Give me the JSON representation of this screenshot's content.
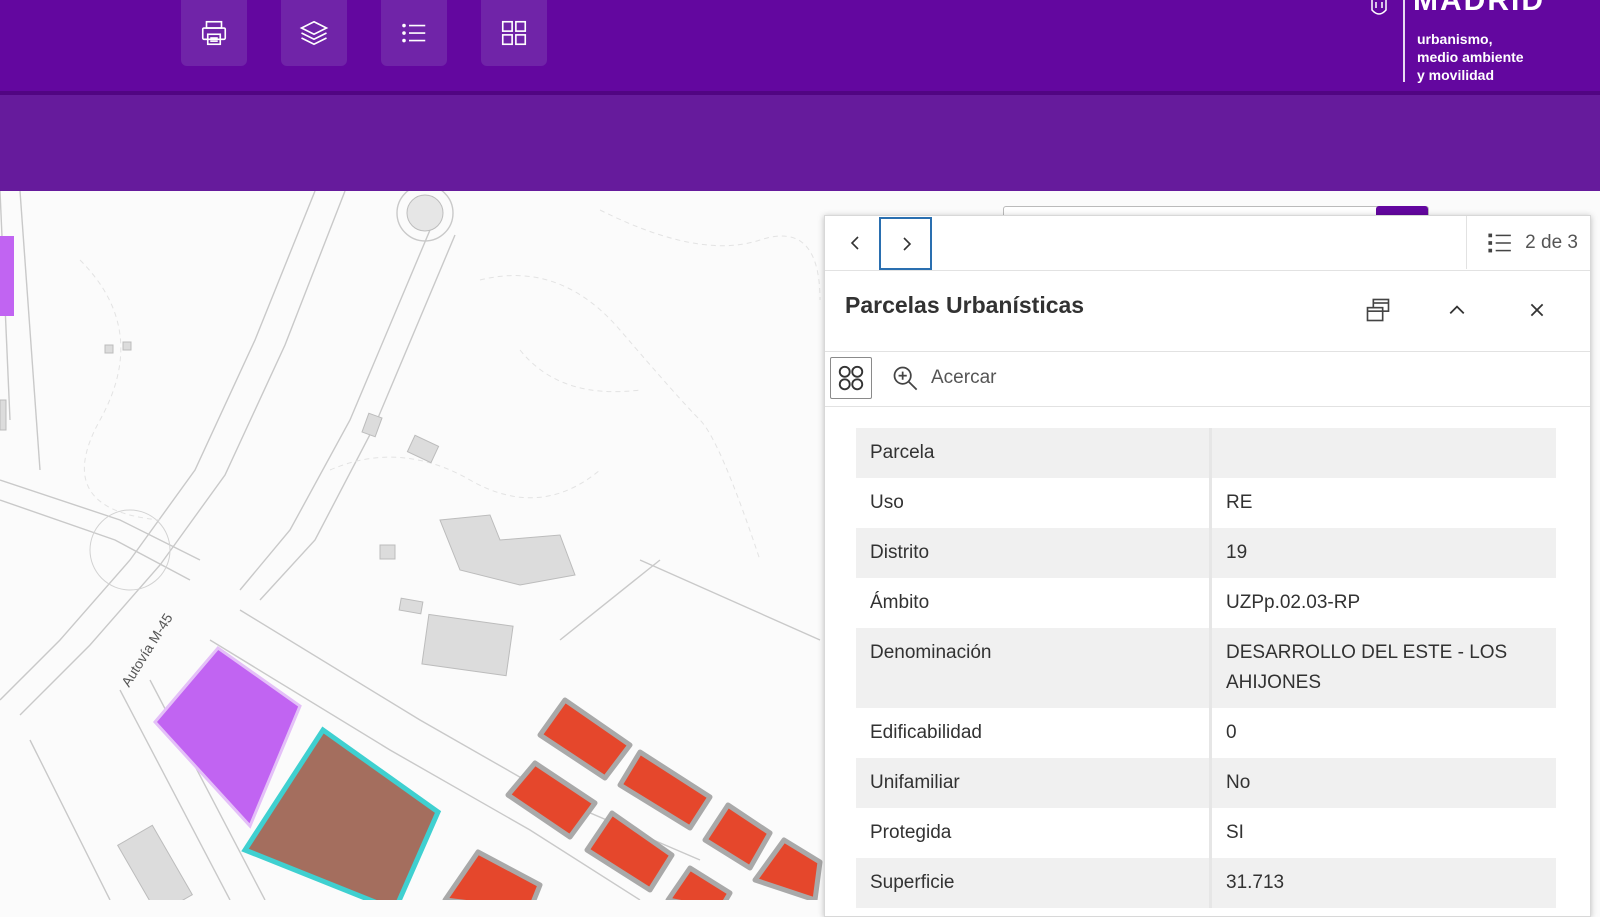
{
  "colors": {
    "header": "#63079f",
    "subheader": "#661b9c",
    "accent": "#2a6fb0",
    "parcel_red": "#e5472c",
    "parcel_purple": "#c164f2",
    "parcel_brown": "#a46e5e",
    "highlight": "#3fd0d0"
  },
  "toolbar": [
    {
      "icon": "printer-icon",
      "label": "Imprimir"
    },
    {
      "icon": "layers-icon",
      "label": "Capas"
    },
    {
      "icon": "list-icon",
      "label": "Leyenda"
    },
    {
      "icon": "grid-icon",
      "label": "Mapas base"
    }
  ],
  "logo": {
    "title": "MADRID",
    "lines": [
      "urbanismo,",
      "medio ambiente",
      "y movilidad"
    ]
  },
  "map": {
    "road_label": "Autovía M-45"
  },
  "popup": {
    "counter": "2 de 3",
    "title": "Parcelas Urbanísticas",
    "zoom_label": "Acercar",
    "rows": [
      {
        "key": "Parcela",
        "value": ""
      },
      {
        "key": "Uso",
        "value": "RE"
      },
      {
        "key": "Distrito",
        "value": "19"
      },
      {
        "key": "Ámbito",
        "value": "UZPp.02.03-RP"
      },
      {
        "key": "Denominación",
        "value": "DESARROLLO DEL ESTE - LOS AHIJONES"
      },
      {
        "key": "Edificabilidad",
        "value": "0"
      },
      {
        "key": "Unifamiliar",
        "value": "No"
      },
      {
        "key": "Protegida",
        "value": "SI"
      },
      {
        "key": "Superficie",
        "value": "31.713"
      }
    ]
  }
}
